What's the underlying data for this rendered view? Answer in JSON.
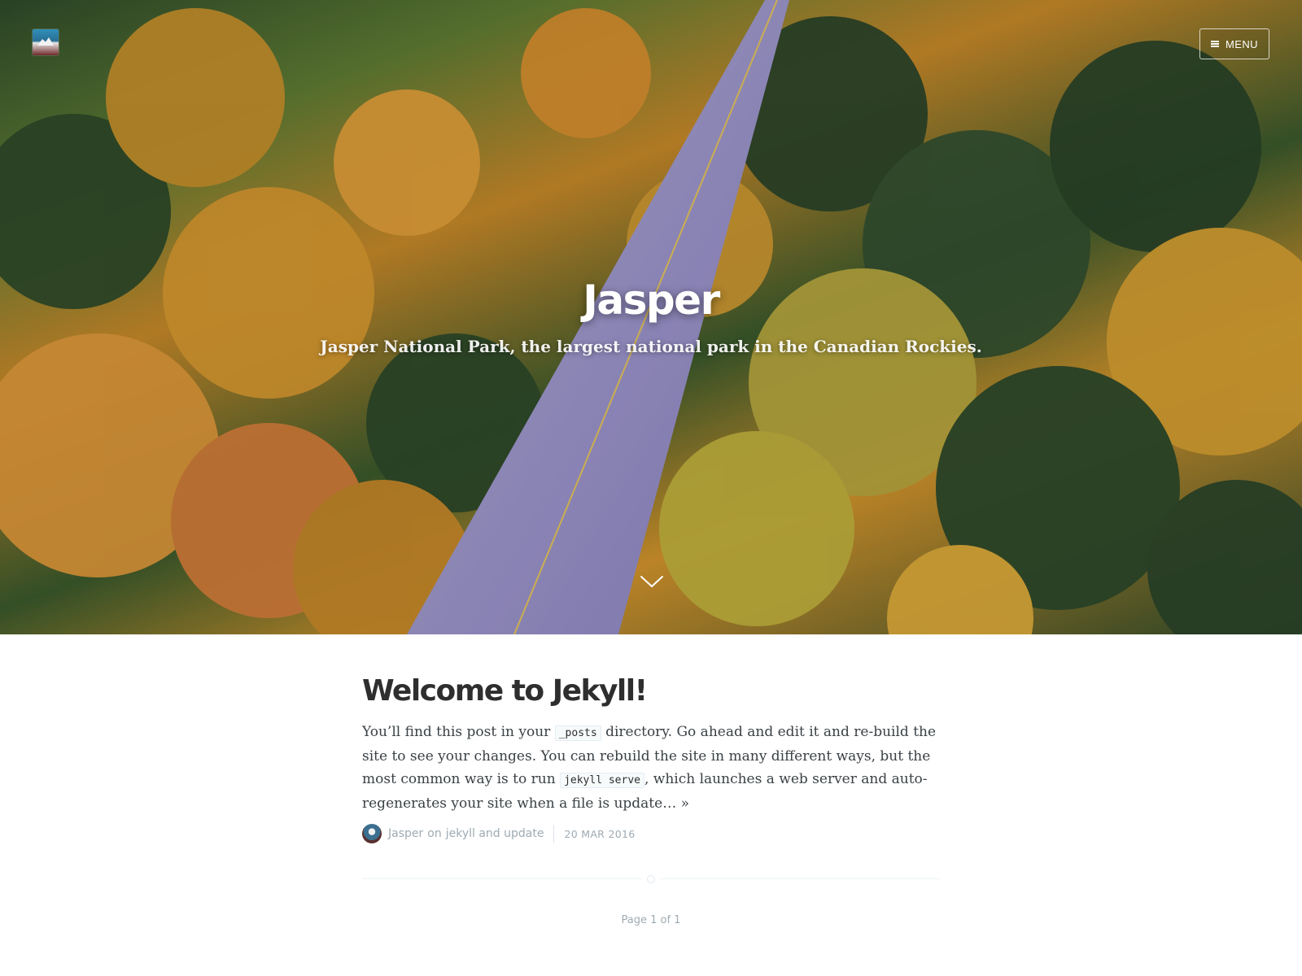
{
  "site": {
    "title": "Jasper",
    "description": "Jasper National Park, the largest national park in the Canadian Rockies."
  },
  "nav": {
    "menu_label": "MENU",
    "menu_icon": "hamburger-icon",
    "logo_icon": "mountain-logo-icon",
    "scroll_icon": "chevron-down-icon"
  },
  "posts": [
    {
      "title": "Welcome to Jekyll!",
      "excerpt_parts": {
        "p1": "You’ll find this post in your ",
        "code1": "_posts",
        "p2": " directory. Go ahead and edit it and re-build the site to see your changes. You can rebuild the site in many different ways, but the most common way is to run ",
        "code2": "jekyll serve",
        "p3": ", which launches a web server and auto-regenerates your site when a file is update…",
        "more": "»"
      },
      "author": "Jasper",
      "on_word": "on",
      "tags": "jekyll and update",
      "date": "20 MAR 2016"
    }
  ],
  "pagination": {
    "text": "Page 1 of 1"
  },
  "colors": {
    "text": "#3a4145",
    "muted": "#9eabb3",
    "title": "#2e2e2e",
    "road": "#9d97cf",
    "autumn": "#d6962c",
    "pine": "#2d4a2b"
  }
}
